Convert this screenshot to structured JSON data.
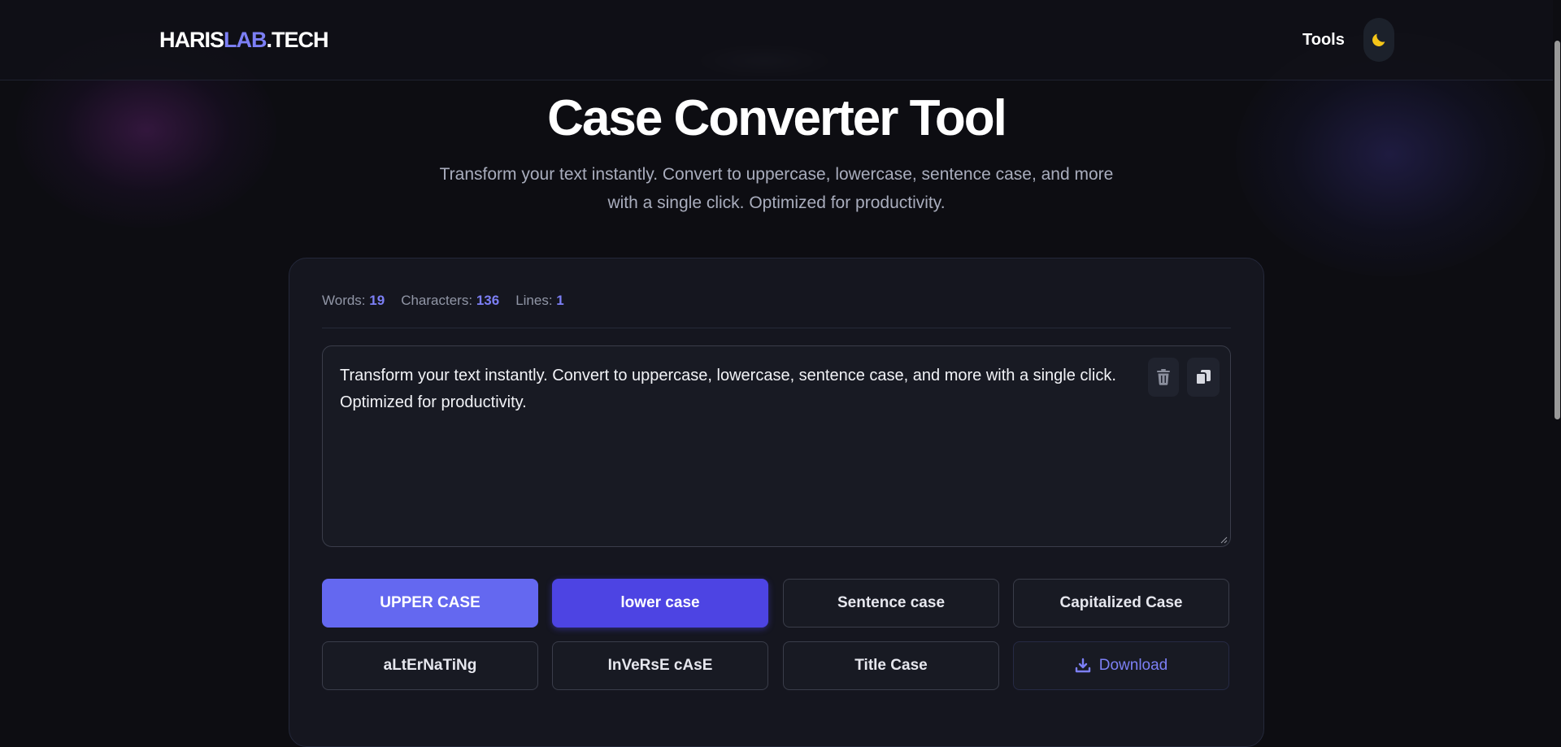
{
  "header": {
    "logo": {
      "part1": "HARIS",
      "part2": "LAB",
      "part3": ".TECH"
    },
    "nav_tools": "Tools",
    "theme_icon": "moon-icon"
  },
  "hero": {
    "title": "Case Converter Tool",
    "subtitle": "Transform your text instantly. Convert to uppercase, lowercase, sentence case, and more with a single click. Optimized for productivity."
  },
  "stats": {
    "words_label": "Words:",
    "words": "19",
    "chars_label": "Characters:",
    "chars": "136",
    "lines_label": "Lines:",
    "lines": "1"
  },
  "editor": {
    "text": "Transform your text instantly. Convert to uppercase, lowercase, sentence case, and more with a single click. Optimized for productivity.",
    "icons": [
      "trash-icon",
      "copy-icon"
    ]
  },
  "buttons": {
    "upper": "UPPER CASE",
    "lower": "lower case",
    "sentence": "Sentence case",
    "capitalized": "Capitalized Case",
    "alternating": "aLtErNaTiNg",
    "inverse": "InVeRsE cAsE",
    "title": "Title Case",
    "download": "Download"
  },
  "colors": {
    "accent": "#7c7ff5",
    "primary_button": "#6468f0",
    "active_button": "#4d44e3",
    "moon": "#f5c518",
    "background": "#0d0d12"
  }
}
